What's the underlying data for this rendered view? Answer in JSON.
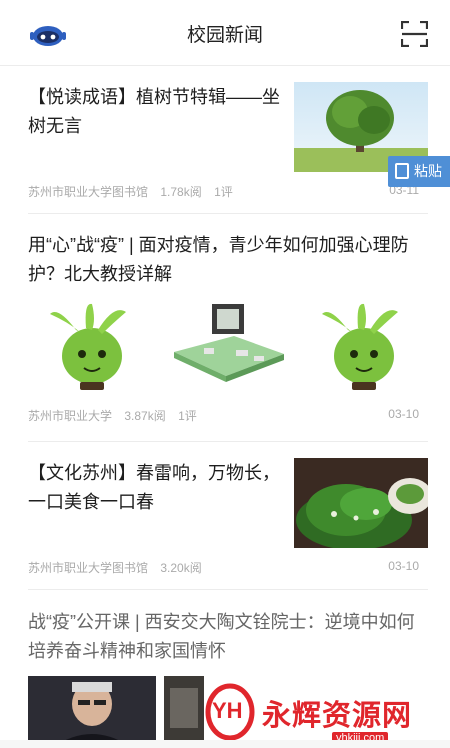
{
  "header": {
    "title": "校园新闻",
    "left_icon": "robot-icon",
    "right_icon": "scan-icon"
  },
  "articles": [
    {
      "title": "【悦读成语】植树节特辑——坐树无言",
      "source": "苏州市职业大学图书馆",
      "views": "1.78k阅",
      "comments": "1评",
      "date": "03-11"
    },
    {
      "title": "用“心”战“疫” | 面对疫情，青少年如何加强心理防护？北大教授详解",
      "source": "苏州市职业大学",
      "views": "3.87k阅",
      "comments": "1评",
      "date": "03-10"
    },
    {
      "title": "【文化苏州】春雷响，万物长，一口美食一口春",
      "source": "苏州市职业大学图书馆",
      "views": "3.20k阅",
      "comments": "",
      "date": "03-10"
    },
    {
      "title": "战“疫”公开课 | 西安交大陶文铨院士：逆境中如何培养奋斗精神和家国情怀",
      "source": "",
      "views": "",
      "comments": "",
      "date": ""
    }
  ],
  "paste_label": "粘贴",
  "watermark": {
    "logo_text": "YH",
    "site_name": "永辉资源网",
    "url": "yhkjjj.com"
  },
  "colors": {
    "accent": "#4f8fd6",
    "watermark_red": "#e0262c",
    "robot_blue": "#2e5fbf"
  }
}
